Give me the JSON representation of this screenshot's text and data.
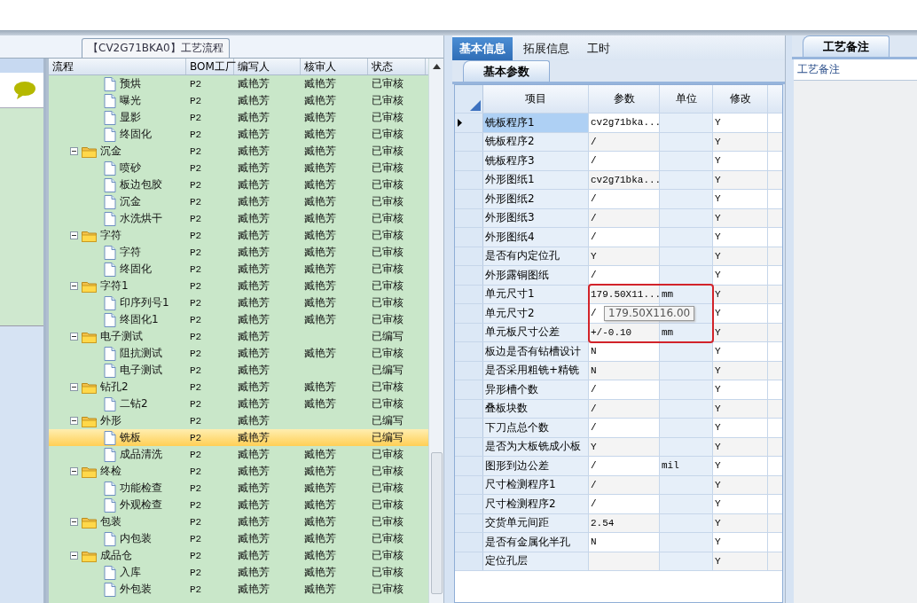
{
  "flow_panel": {
    "title": "【CV2G71BKA0】工艺流程",
    "columns": [
      "流程",
      "BOM工厂",
      "编写人",
      "核审人",
      "状态"
    ],
    "nodes": [
      {
        "kind": "group",
        "children": [
          {
            "kind": "step",
            "name": "预烘",
            "bom": "P2",
            "writer": "臧艳芳",
            "reviewer": "臧艳芳",
            "status": "已审核",
            "selected": false
          },
          {
            "kind": "step",
            "name": "曝光",
            "bom": "P2",
            "writer": "臧艳芳",
            "reviewer": "臧艳芳",
            "status": "已审核",
            "selected": false
          },
          {
            "kind": "step",
            "name": "显影",
            "bom": "P2",
            "writer": "臧艳芳",
            "reviewer": "臧艳芳",
            "status": "已审核",
            "selected": false
          },
          {
            "kind": "step",
            "name": "终固化",
            "bom": "P2",
            "writer": "臧艳芳",
            "reviewer": "臧艳芳",
            "status": "已审核",
            "selected": false
          }
        ]
      },
      {
        "kind": "folder",
        "name": "沉金",
        "bom": "P2",
        "writer": "臧艳芳",
        "reviewer": "臧艳芳",
        "status": "已审核",
        "selected": false,
        "expanded": true,
        "children": [
          {
            "kind": "step",
            "name": "喷砂",
            "bom": "P2",
            "writer": "臧艳芳",
            "reviewer": "臧艳芳",
            "status": "已审核",
            "selected": false
          },
          {
            "kind": "step",
            "name": "板边包胶",
            "bom": "P2",
            "writer": "臧艳芳",
            "reviewer": "臧艳芳",
            "status": "已审核",
            "selected": false
          },
          {
            "kind": "step",
            "name": "沉金",
            "bom": "P2",
            "writer": "臧艳芳",
            "reviewer": "臧艳芳",
            "status": "已审核",
            "selected": false
          },
          {
            "kind": "step",
            "name": "水洗烘干",
            "bom": "P2",
            "writer": "臧艳芳",
            "reviewer": "臧艳芳",
            "status": "已审核",
            "selected": false
          }
        ]
      },
      {
        "kind": "folder",
        "name": "字符",
        "bom": "P2",
        "writer": "臧艳芳",
        "reviewer": "臧艳芳",
        "status": "已审核",
        "selected": false,
        "expanded": true,
        "children": [
          {
            "kind": "step",
            "name": "字符",
            "bom": "P2",
            "writer": "臧艳芳",
            "reviewer": "臧艳芳",
            "status": "已审核",
            "selected": false
          },
          {
            "kind": "step",
            "name": "终固化",
            "bom": "P2",
            "writer": "臧艳芳",
            "reviewer": "臧艳芳",
            "status": "已审核",
            "selected": false
          }
        ]
      },
      {
        "kind": "folder",
        "name": "字符1",
        "bom": "P2",
        "writer": "臧艳芳",
        "reviewer": "臧艳芳",
        "status": "已审核",
        "selected": false,
        "expanded": true,
        "children": [
          {
            "kind": "step",
            "name": "印序列号1",
            "bom": "P2",
            "writer": "臧艳芳",
            "reviewer": "臧艳芳",
            "status": "已审核",
            "selected": false
          },
          {
            "kind": "step",
            "name": "终固化1",
            "bom": "P2",
            "writer": "臧艳芳",
            "reviewer": "臧艳芳",
            "status": "已审核",
            "selected": false
          }
        ]
      },
      {
        "kind": "folder",
        "name": "电子测试",
        "bom": "P2",
        "writer": "臧艳芳",
        "status": "已编写",
        "selected": false,
        "expanded": true,
        "children": [
          {
            "kind": "step",
            "name": "阻抗测试",
            "bom": "P2",
            "writer": "臧艳芳",
            "reviewer": "臧艳芳",
            "status": "已审核",
            "selected": false
          },
          {
            "kind": "step",
            "name": "电子测试",
            "bom": "P2",
            "writer": "臧艳芳",
            "status": "已编写",
            "selected": false
          }
        ]
      },
      {
        "kind": "folder",
        "name": "钻孔2",
        "bom": "P2",
        "writer": "臧艳芳",
        "reviewer": "臧艳芳",
        "status": "已审核",
        "selected": false,
        "expanded": true,
        "children": [
          {
            "kind": "step",
            "name": "二钻2",
            "bom": "P2",
            "writer": "臧艳芳",
            "reviewer": "臧艳芳",
            "status": "已审核",
            "selected": false
          }
        ]
      },
      {
        "kind": "folder",
        "name": "外形",
        "bom": "P2",
        "writer": "臧艳芳",
        "status": "已编写",
        "selected": false,
        "expanded": true,
        "children": [
          {
            "kind": "step",
            "name": "铣板",
            "bom": "P2",
            "writer": "臧艳芳",
            "status": "已编写",
            "selected": true
          },
          {
            "kind": "step",
            "name": "成品清洗",
            "bom": "P2",
            "writer": "臧艳芳",
            "reviewer": "臧艳芳",
            "status": "已审核",
            "selected": false
          }
        ]
      },
      {
        "kind": "folder",
        "name": "终检",
        "bom": "P2",
        "writer": "臧艳芳",
        "reviewer": "臧艳芳",
        "status": "已审核",
        "selected": false,
        "expanded": true,
        "children": [
          {
            "kind": "step",
            "name": "功能检查",
            "bom": "P2",
            "writer": "臧艳芳",
            "reviewer": "臧艳芳",
            "status": "已审核",
            "selected": false
          },
          {
            "kind": "step",
            "name": "外观检查",
            "bom": "P2",
            "writer": "臧艳芳",
            "reviewer": "臧艳芳",
            "status": "已审核",
            "selected": false
          }
        ]
      },
      {
        "kind": "folder",
        "name": "包装",
        "bom": "P2",
        "writer": "臧艳芳",
        "reviewer": "臧艳芳",
        "status": "已审核",
        "selected": false,
        "expanded": true,
        "children": [
          {
            "kind": "step",
            "name": "内包装",
            "bom": "P2",
            "writer": "臧艳芳",
            "reviewer": "臧艳芳",
            "status": "已审核",
            "selected": false
          }
        ]
      },
      {
        "kind": "folder",
        "name": "成品仓",
        "bom": "P2",
        "writer": "臧艳芳",
        "reviewer": "臧艳芳",
        "status": "已审核",
        "selected": false,
        "expanded": true,
        "children": [
          {
            "kind": "step",
            "name": "入库",
            "bom": "P2",
            "writer": "臧艳芳",
            "reviewer": "臧艳芳",
            "status": "已审核",
            "selected": false
          },
          {
            "kind": "step",
            "name": "外包装",
            "bom": "P2",
            "writer": "臧艳芳",
            "reviewer": "臧艳芳",
            "status": "已审核",
            "selected": false
          }
        ]
      }
    ]
  },
  "tabs": [
    {
      "label": "基本信息",
      "selected": true
    },
    {
      "label": "拓展信息",
      "selected": false
    },
    {
      "label": "工时",
      "selected": false
    }
  ],
  "params_panel": {
    "tab": "基本参数",
    "columns": [
      "项目",
      "参数",
      "单位",
      "修改"
    ],
    "rows": [
      {
        "item": "铣板程序1",
        "param": "cv2g71bka...",
        "modify": "Y",
        "selected": true
      },
      {
        "item": "铣板程序2",
        "param": "/",
        "modify": "Y",
        "selected": false
      },
      {
        "item": "铣板程序3",
        "param": "/",
        "modify": "Y",
        "selected": false
      },
      {
        "item": "外形图纸1",
        "param": "cv2g71bka...",
        "modify": "Y",
        "selected": false
      },
      {
        "item": "外形图纸2",
        "param": "/",
        "modify": "Y",
        "selected": false
      },
      {
        "item": "外形图纸3",
        "param": "/",
        "modify": "Y",
        "selected": false
      },
      {
        "item": "外形图纸4",
        "param": "/",
        "modify": "Y",
        "selected": false
      },
      {
        "item": "是否有内定位孔",
        "param": "Y",
        "modify": "Y",
        "selected": false
      },
      {
        "item": "外形露铜图纸",
        "param": "/",
        "modify": "Y",
        "selected": false
      },
      {
        "item": "单元尺寸1",
        "param": "179.50X11...",
        "unit": "mm",
        "modify": "Y",
        "selected": false
      },
      {
        "item": "单元尺寸2",
        "param": "/",
        "modify": "Y",
        "selected": false
      },
      {
        "item": "单元板尺寸公差",
        "param": "+/-0.10",
        "unit": "mm",
        "modify": "Y",
        "selected": false
      },
      {
        "item": "板边是否有钻槽设计",
        "param": "N",
        "modify": "Y",
        "selected": false
      },
      {
        "item": "是否采用粗铣+精铣",
        "param": "N",
        "modify": "Y",
        "selected": false
      },
      {
        "item": "异形槽个数",
        "param": "/",
        "modify": "Y",
        "selected": false
      },
      {
        "item": "叠板块数",
        "param": "/",
        "modify": "Y",
        "selected": false
      },
      {
        "item": "下刀点总个数",
        "param": "/",
        "modify": "Y",
        "selected": false
      },
      {
        "item": "是否为大板铣成小板",
        "param": "Y",
        "modify": "Y",
        "selected": false
      },
      {
        "item": "图形到边公差",
        "param": "/",
        "unit": "mil",
        "modify": "Y",
        "selected": false
      },
      {
        "item": "尺寸检测程序1",
        "param": "/",
        "modify": "Y",
        "selected": false
      },
      {
        "item": "尺寸检测程序2",
        "param": "/",
        "modify": "Y",
        "selected": false
      },
      {
        "item": "交货单元间距",
        "param": "2.54",
        "modify": "Y",
        "selected": false
      },
      {
        "item": "是否有金属化半孔",
        "param": "N",
        "modify": "Y",
        "selected": false
      },
      {
        "item": "定位孔层",
        "modify": "Y",
        "selected": false
      }
    ],
    "tooltip": "179.50X116.00"
  },
  "notes_panel": {
    "tab": "工艺备注",
    "label": "工艺备注"
  }
}
